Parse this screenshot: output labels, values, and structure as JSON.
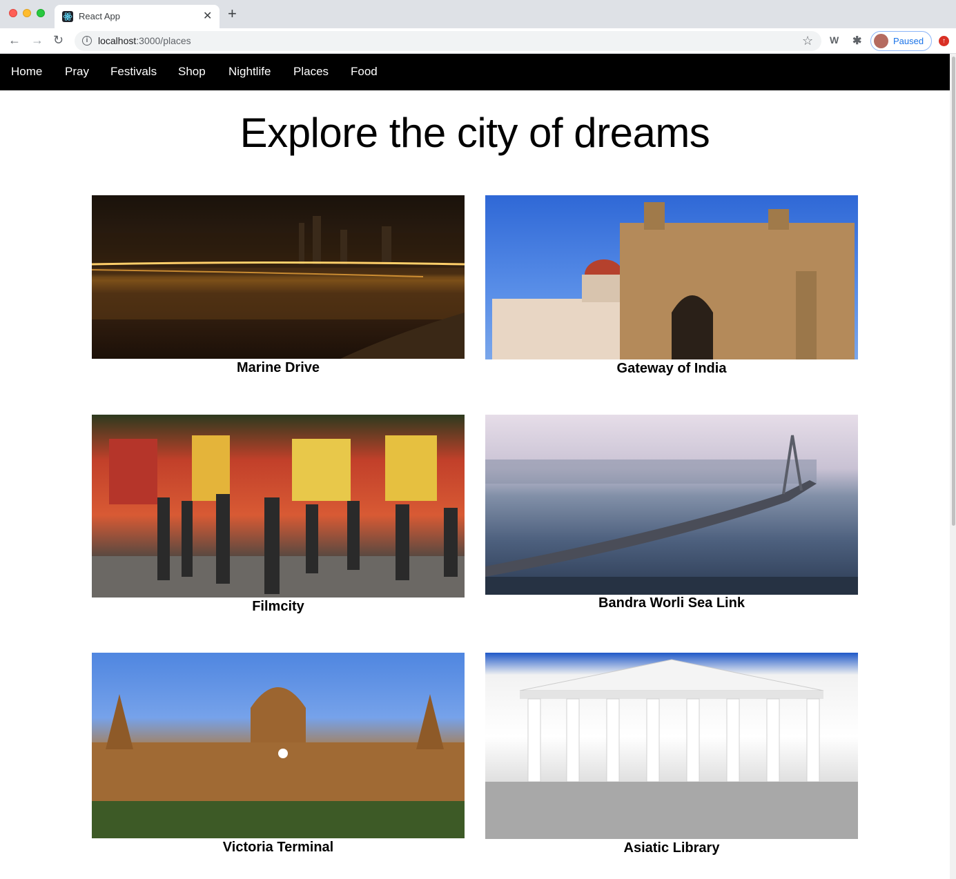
{
  "browser": {
    "tab_title": "React App",
    "tab_close": "✕",
    "new_tab": "+",
    "url_host": "localhost",
    "url_path": ":3000/places",
    "profile_label": "Paused",
    "back": "←",
    "forward": "→",
    "reload": "↻",
    "star": "☆",
    "ext1": "W",
    "ext2": "✱",
    "update": "↑"
  },
  "nav": {
    "items": [
      "Home",
      "Pray",
      "Festivals",
      "Shop",
      "Nightlife",
      "Places",
      "Food"
    ]
  },
  "main": {
    "title": "Explore the city of dreams",
    "places": [
      {
        "caption": "Marine Drive"
      },
      {
        "caption": "Gateway of India"
      },
      {
        "caption": "Filmcity"
      },
      {
        "caption": "Bandra Worli Sea Link"
      },
      {
        "caption": "Victoria Terminal"
      },
      {
        "caption": "Asiatic Library"
      }
    ]
  },
  "colors": {
    "nav_background": "#000000",
    "nav_text": "#ffffff",
    "profile_accent": "#1a73e8"
  }
}
